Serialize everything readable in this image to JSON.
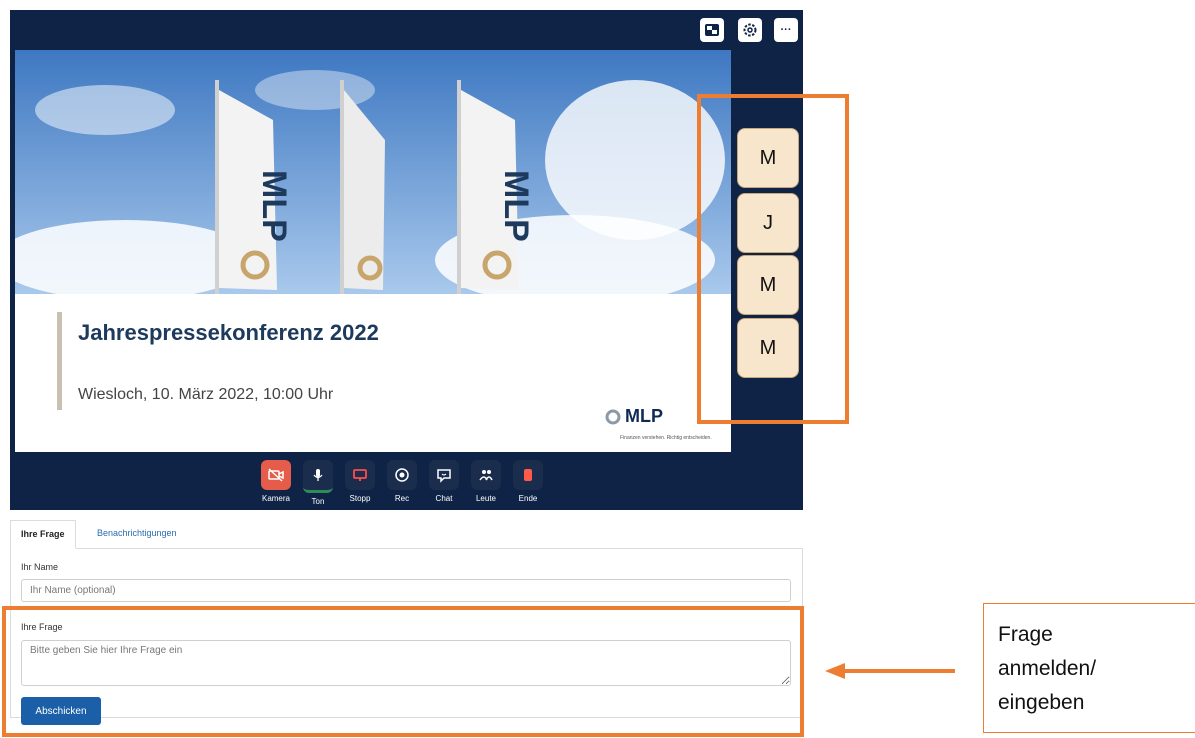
{
  "top_controls": [
    {
      "name": "picture-in-picture-icon"
    },
    {
      "name": "gear-icon"
    },
    {
      "name": "more-icon",
      "glyph": "···"
    }
  ],
  "slide": {
    "title": "Jahrespressekonferenz 2022",
    "subtitle": "Wiesloch, 10. März 2022, 10:00 Uhr",
    "logo_text": "MLP",
    "tagline": "Finanzen verstehen. Richtig entscheiden.",
    "flag_text": "MLP"
  },
  "participants": [
    "M",
    "J",
    "M",
    "M"
  ],
  "toolbar": [
    {
      "label": "Kamera",
      "icon": "camera-off-icon",
      "bg": "#e55d4a"
    },
    {
      "label": "Ton",
      "icon": "microphone-icon"
    },
    {
      "label": "Stopp",
      "icon": "stop-share-icon"
    },
    {
      "label": "Rec",
      "icon": "record-icon"
    },
    {
      "label": "Chat",
      "icon": "chat-icon"
    },
    {
      "label": "Leute",
      "icon": "people-icon"
    },
    {
      "label": "Ende",
      "icon": "end-call-icon"
    }
  ],
  "form": {
    "tabs": [
      "Ihre Frage",
      "Benachrichtigungen"
    ],
    "name_label": "Ihr Name",
    "name_placeholder": "Ihr Name (optional)",
    "question_label": "Ihre Frage",
    "question_placeholder": "Bitte geben Sie hier Ihre Frage ein",
    "submit_label": "Abschicken"
  },
  "callout": {
    "line1": "Frage",
    "line2": "anmelden/",
    "line3": "eingeben"
  },
  "colors": {
    "panel_bg": "#0f2347",
    "highlight": "#ed7d31",
    "button_blue": "#1a5fa8",
    "participant_bg": "#f7e6cc"
  }
}
